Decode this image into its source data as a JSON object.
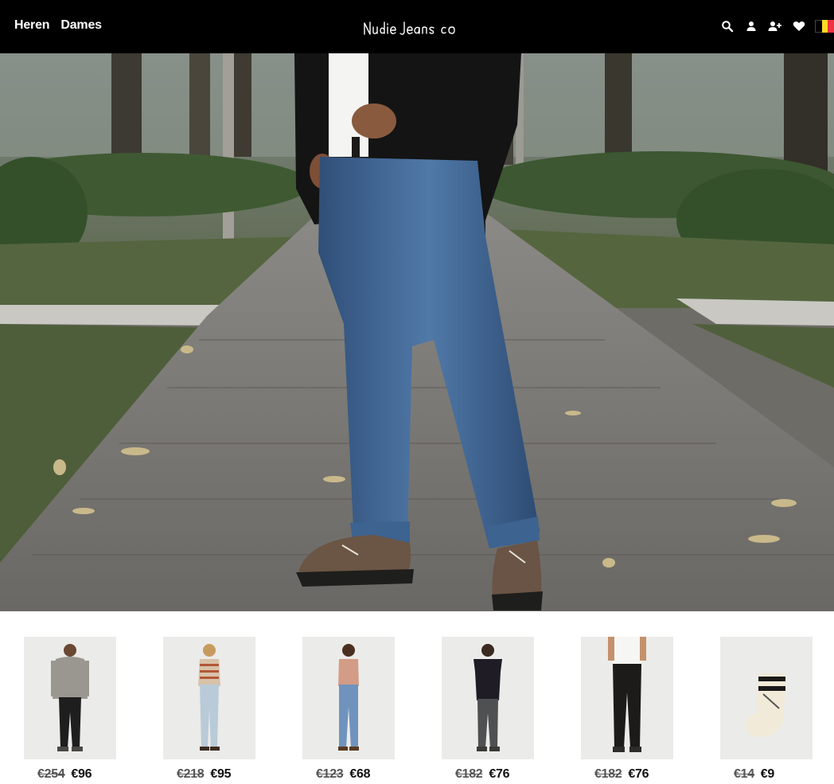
{
  "header": {
    "nav": [
      "Heren",
      "Dames"
    ],
    "logo_text": "Nudie Jeans co",
    "icons": [
      "search-icon",
      "user-icon",
      "add-user-icon",
      "heart-icon"
    ],
    "flag_colors": [
      "#000000",
      "#FDDA24",
      "#EF3340"
    ]
  },
  "hero": {
    "alt": "man in jeans on a park path"
  },
  "products": [
    {
      "old_price": "€254",
      "new_price": "€96"
    },
    {
      "old_price": "€218",
      "new_price": "€95"
    },
    {
      "old_price": "€123",
      "new_price": "€68"
    },
    {
      "old_price": "€182",
      "new_price": "€76"
    },
    {
      "old_price": "€182",
      "new_price": "€76"
    },
    {
      "old_price": "€14",
      "new_price": "€9"
    }
  ]
}
